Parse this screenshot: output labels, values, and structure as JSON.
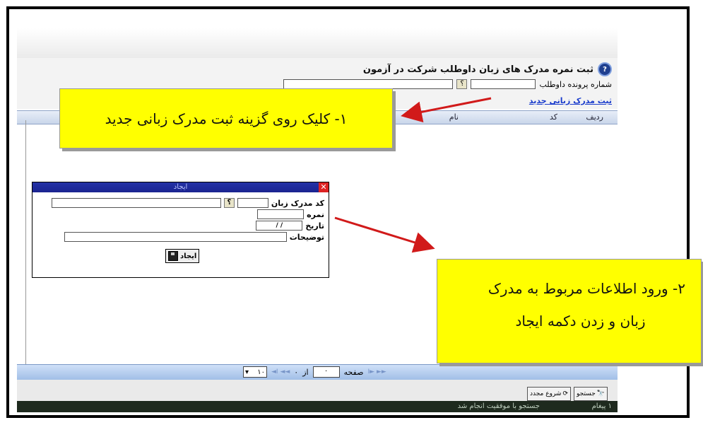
{
  "header": {
    "title": "ثبت نمره مدرک های زبان داوطلب شرکت در آزمون",
    "file_number_label": "شماره پرونده داوطلب",
    "new_link": "ثبت مدرک زبانی جدید"
  },
  "grid": {
    "columns": [
      "ردیف",
      "کد",
      "نام"
    ]
  },
  "dialog": {
    "title": "ایجاد",
    "lang_code_label": "کد مدرک زبان",
    "score_label": "نمره",
    "date_label": "تاریخ",
    "date_value": "/ /",
    "desc_label": "توضیحات",
    "create_button": "ایجاد"
  },
  "pager": {
    "page_label": "صفحه",
    "page_value": "۰",
    "of_label": "از",
    "total_pages": "۰",
    "page_size": "۱۰"
  },
  "tools": {
    "search_button": "جستجو",
    "restart_button": "شروع مجدد"
  },
  "status": {
    "message": "جستجو با موفقیت انجام شد",
    "count": "۱ پیغام"
  },
  "callouts": {
    "step1": "۱- کلیک روی گزینه ثبت مدرک زبانی جدید",
    "step2_line1": "۲- ورود اطلاعات مربوط به مدرک",
    "step2_line2": "زبان و زدن دکمه ایجاد"
  },
  "colors": {
    "callout": "#ffff00",
    "arrow": "#d11a1a",
    "dialog_title": "#2432a6",
    "link": "#1a3ccc"
  }
}
